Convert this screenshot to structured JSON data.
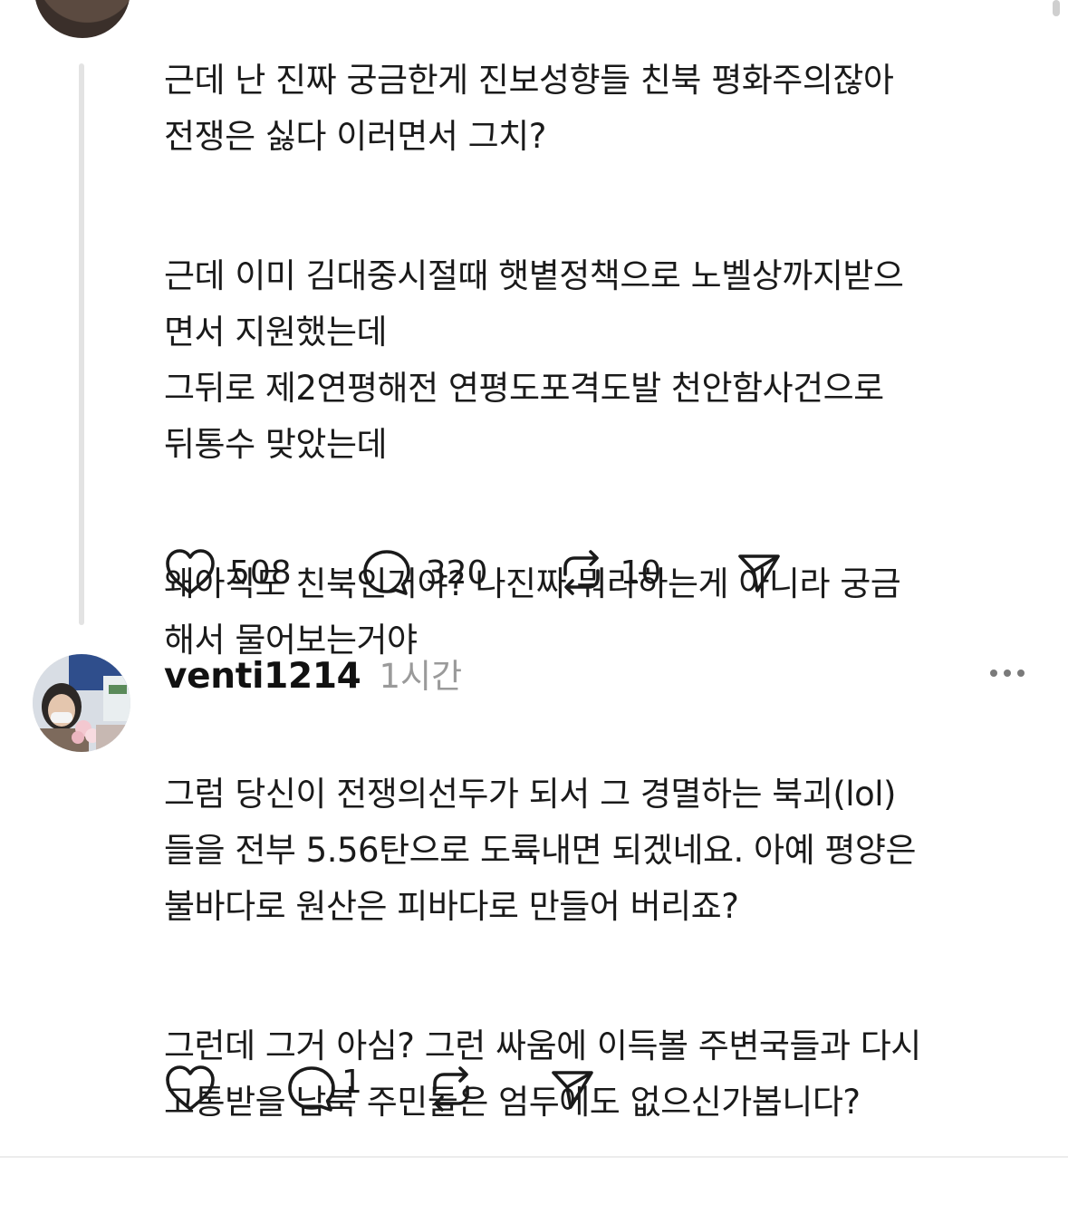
{
  "posts": [
    {
      "paragraphs": [
        "근데 난 진짜 궁금한게 진보성향들 친북 평화주의잖아\n전쟁은 싫다 이러면서 그치?",
        "근데 이미 김대중시절때 햇볕정책으로 노벨상까지받으\n면서 지원했는데\n그뒤로 제2연평해전 연평도포격도발 천안함사건으로\n뒤통수 맞았는데",
        "왜아직도 친북인거야? 나진짜 뭐라하는게 아니라 궁금\n해서 물어보는거야"
      ],
      "actions": {
        "likes": "508",
        "replies": "320",
        "reposts": "10"
      }
    },
    {
      "author": "venti1214",
      "time": "1시간",
      "paragraphs": [
        "그럼 당신이 전쟁의선두가 되서 그 경멸하는 북괴(lol)\n들을 전부 5.56탄으로 도륙내면 되겠네요. 아예 평양은\n불바다로 원산은 피바다로 만들어 버리죠?",
        "그런데 그거 아심? 그런 싸움에 이득볼 주변국들과 다시\n고통받을 남북 주민들은 엄두에도 없으신가봅니다?"
      ],
      "actions": {
        "likes": "",
        "replies": "1",
        "reposts": ""
      }
    }
  ],
  "icons": {
    "like": "heart-icon",
    "reply": "speech-bubble-icon",
    "repost": "repost-arrows-icon",
    "share": "paper-plane-icon",
    "more": "more-dots-icon"
  },
  "colors": {
    "text": "#1a1a1a",
    "muted": "#9a9a9a",
    "thread_line": "#e3e3e3"
  }
}
